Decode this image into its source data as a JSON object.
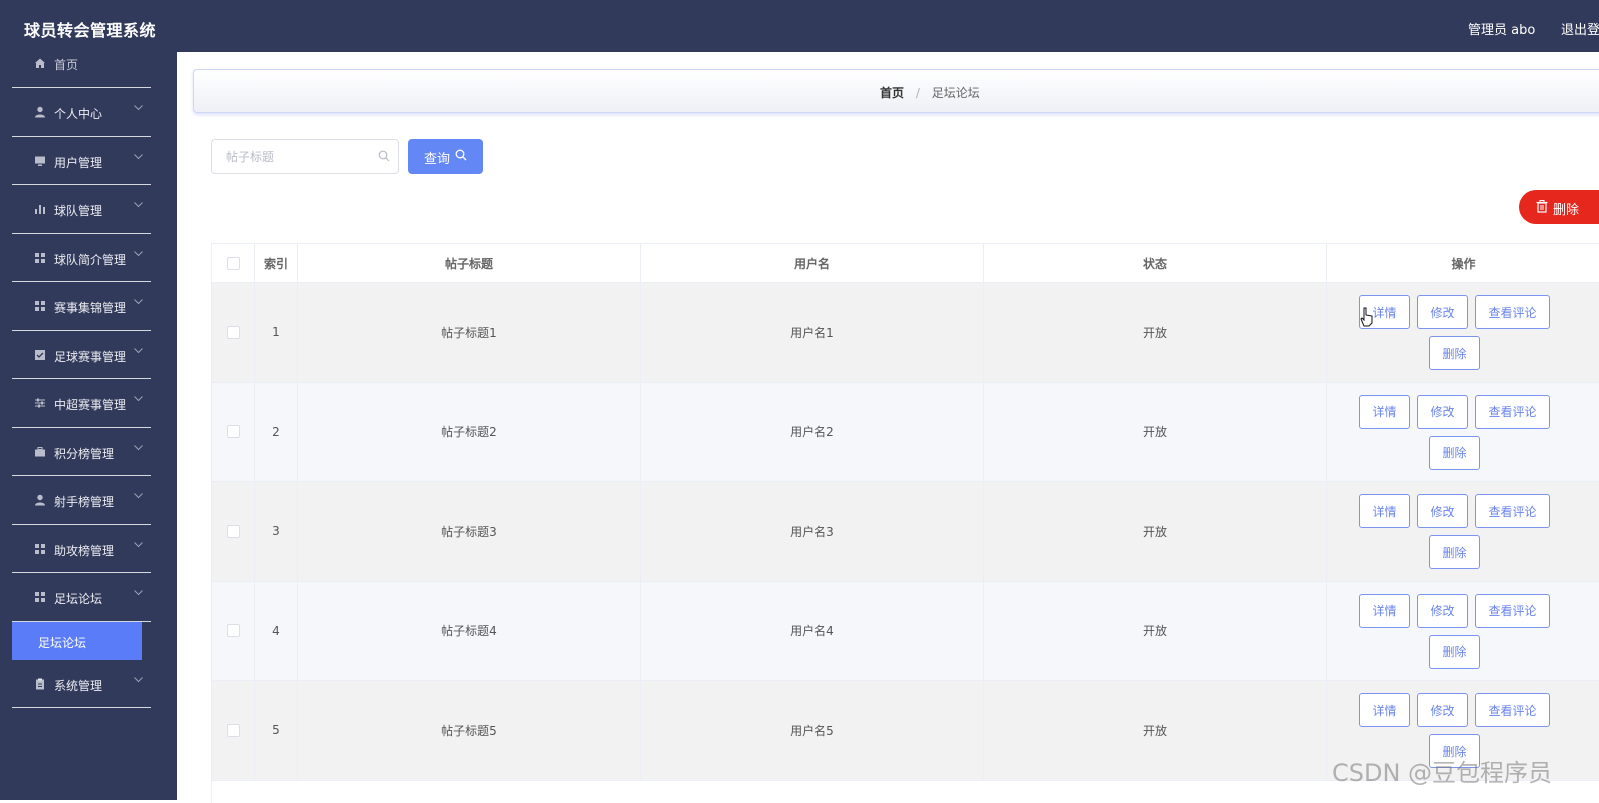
{
  "header": {
    "app_title": "球员转会管理系统",
    "admin_label": "管理员 abo",
    "logout_label": "退出登"
  },
  "sidebar": {
    "home_label": "首页",
    "items": [
      {
        "label": "个人中心",
        "icon": "person-icon"
      },
      {
        "label": "用户管理",
        "icon": "monitor-icon"
      },
      {
        "label": "球队管理",
        "icon": "bar-chart-icon"
      },
      {
        "label": "球队简介管理",
        "icon": "grid-icon"
      },
      {
        "label": "赛事集锦管理",
        "icon": "grid-icon"
      },
      {
        "label": "足球赛事管理",
        "icon": "checkbox-icon"
      },
      {
        "label": "中超赛事管理",
        "icon": "sliders-icon"
      },
      {
        "label": "积分榜管理",
        "icon": "briefcase-icon"
      },
      {
        "label": "射手榜管理",
        "icon": "person-icon"
      },
      {
        "label": "助攻榜管理",
        "icon": "grid-icon"
      },
      {
        "label": "足坛论坛",
        "icon": "grid-icon"
      },
      {
        "label": "系统管理",
        "icon": "clipboard-icon"
      }
    ],
    "active_submenu": "足坛论坛"
  },
  "breadcrumb": {
    "home": "首页",
    "separator": "/",
    "current": "足坛论坛"
  },
  "search": {
    "placeholder": "帖子标题",
    "value": "",
    "query_label": "查询"
  },
  "toolbar": {
    "delete_label": "删除"
  },
  "table": {
    "columns": [
      "索引",
      "帖子标题",
      "用户名",
      "状态",
      "操作"
    ],
    "actions": {
      "detail": "详情",
      "edit": "修改",
      "comments": "查看评论",
      "delete": "删除"
    },
    "rows": [
      {
        "index": "1",
        "title": "帖子标题1",
        "username": "用户名1",
        "status": "开放"
      },
      {
        "index": "2",
        "title": "帖子标题2",
        "username": "用户名2",
        "status": "开放"
      },
      {
        "index": "3",
        "title": "帖子标题3",
        "username": "用户名3",
        "status": "开放"
      },
      {
        "index": "4",
        "title": "帖子标题4",
        "username": "用户名4",
        "status": "开放"
      },
      {
        "index": "5",
        "title": "帖子标题5",
        "username": "用户名5",
        "status": "开放"
      }
    ]
  },
  "watermark": "CSDN @豆包程序员",
  "colors": {
    "topbar": "#313a5a",
    "accent": "#5b7cf8",
    "danger": "#e5271e",
    "action_border": "#7d93f0"
  }
}
